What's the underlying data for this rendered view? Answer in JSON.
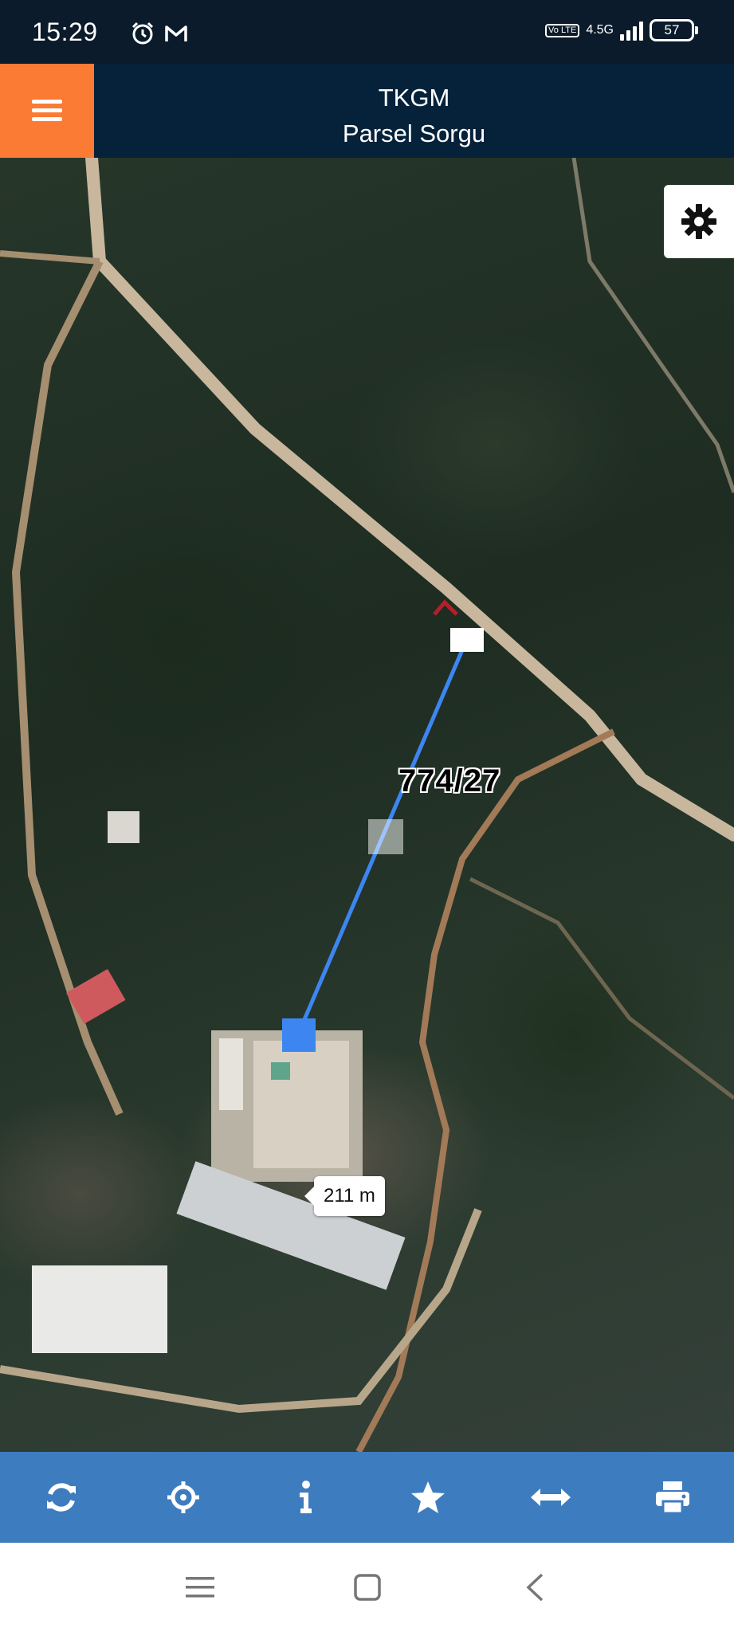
{
  "status_bar": {
    "time": "15:29",
    "volte": "Vo LTE",
    "network": "4.5G",
    "battery": "57"
  },
  "header": {
    "title": "TKGM",
    "subtitle": "Parsel Sorgu"
  },
  "map": {
    "parcel_label": "774/27",
    "distance_label": "211 m",
    "measure_line_color": "#3d86f2"
  },
  "toolbar": {
    "items": [
      "refresh-icon",
      "locate-icon",
      "info-icon",
      "star-icon",
      "measure-icon",
      "print-icon"
    ]
  },
  "colors": {
    "header_bg": "#06223a",
    "menu_accent": "#fb7a34",
    "toolbar_bg": "#3d7cbf"
  }
}
